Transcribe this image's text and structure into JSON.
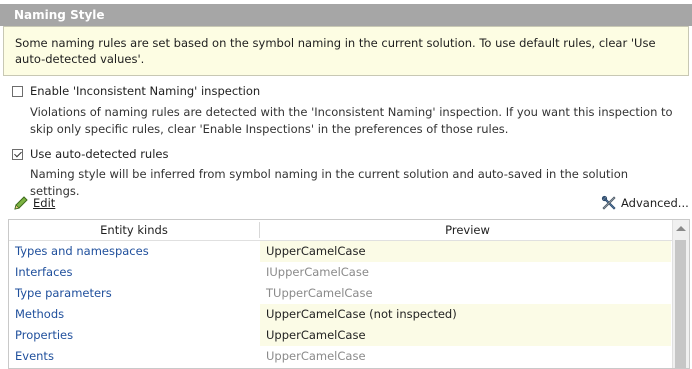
{
  "header": {
    "title": "Naming Style"
  },
  "info": {
    "text": "Some naming rules are set based on the symbol naming in the current solution. To use default rules, clear 'Use auto-detected values'."
  },
  "options": [
    {
      "label": "Enable 'Inconsistent Naming' inspection",
      "checked": false,
      "description": "Violations of naming rules are detected with the 'Inconsistent Naming' inspection. If you want this inspection to skip only specific rules, clear 'Enable Inspections' in the preferences of those rules."
    },
    {
      "label": "Use auto-detected rules",
      "checked": true,
      "description": "Naming style will be inferred from symbol naming in the current solution and auto-saved in the solution settings."
    }
  ],
  "toolbar": {
    "edit_label": "Edit",
    "advanced_label": "Advanced..."
  },
  "table": {
    "columns": [
      "Entity kinds",
      "Preview"
    ],
    "rows": [
      {
        "kind": "Types and namespaces",
        "preview": "UpperCamelCase",
        "highlighted": true
      },
      {
        "kind": "Interfaces",
        "preview": "IUpperCamelCase",
        "highlighted": false
      },
      {
        "kind": "Type parameters",
        "preview": "TUpperCamelCase",
        "highlighted": false
      },
      {
        "kind": "Methods",
        "preview": "UpperCamelCase (not inspected)",
        "highlighted": true
      },
      {
        "kind": "Properties",
        "preview": "UpperCamelCase",
        "highlighted": true
      },
      {
        "kind": "Events",
        "preview": "UpperCamelCase",
        "highlighted": false
      }
    ]
  },
  "colors": {
    "header_bg": "#a6a6a6",
    "info_bg": "#fdfde3",
    "link_blue": "#1f4f9c",
    "highlight_bg": "#fbfbe6"
  }
}
